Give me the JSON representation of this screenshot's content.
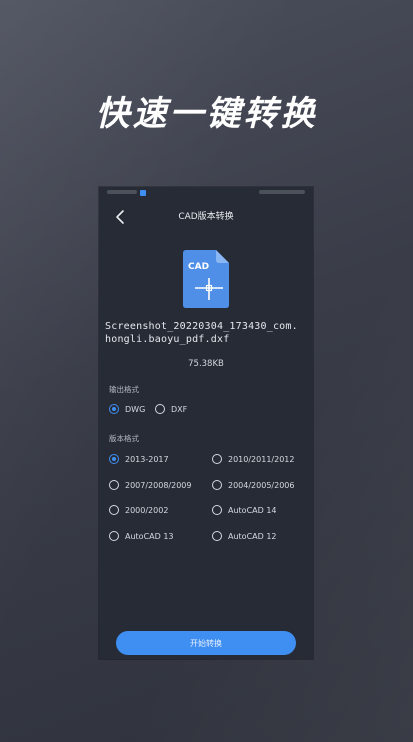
{
  "headline": "快速一键转换",
  "phone": {
    "nav_title": "CAD版本转换",
    "icon_label": "CAD",
    "file_name": "Screenshot_20220304_173430_com.\nhongli.baoyu_pdf.dxf",
    "file_size": "75.38KB",
    "output_format_label": "输出格式",
    "output_formats": [
      {
        "label": "DWG",
        "selected": true
      },
      {
        "label": "DXF",
        "selected": false
      }
    ],
    "version_label": "版本格式",
    "versions": [
      {
        "label": "2013-2017",
        "selected": true
      },
      {
        "label": "2010/2011/2012",
        "selected": false
      },
      {
        "label": "2007/2008/2009",
        "selected": false
      },
      {
        "label": "2004/2005/2006",
        "selected": false
      },
      {
        "label": "2000/2002",
        "selected": false
      },
      {
        "label": "AutoCAD 14",
        "selected": false
      },
      {
        "label": "AutoCAD 13",
        "selected": false
      },
      {
        "label": "AutoCAD 12",
        "selected": false
      }
    ],
    "start_button": "开始转换"
  },
  "colors": {
    "accent": "#3f8ff3",
    "panel": "#272b35",
    "background": "#3a3d48"
  }
}
